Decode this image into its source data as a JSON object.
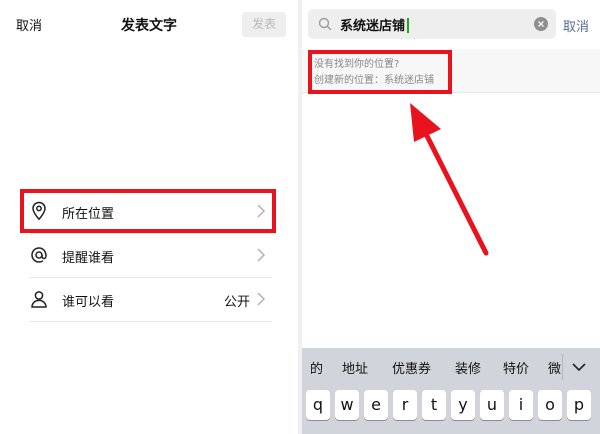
{
  "left_pane": {
    "cancel_label": "取消",
    "title": "发表文字",
    "publish_label": "发表",
    "rows": [
      {
        "icon": "location-pin-icon",
        "label": "所在位置",
        "value": ""
      },
      {
        "icon": "at-sign-icon",
        "label": "提醒谁看",
        "value": ""
      },
      {
        "icon": "person-icon",
        "label": "谁可以看",
        "value": "公开"
      }
    ]
  },
  "right_pane": {
    "search": {
      "value": "系统迷店铺",
      "icon": "search-icon",
      "clear_icon": "clear-icon"
    },
    "cancel_label": "取消",
    "result": {
      "line1": "没有找到你的位置?",
      "line2": "创建新的位置：系统迷店铺"
    }
  },
  "keyboard": {
    "suggestions": [
      "的",
      "地址",
      "优惠券",
      "装修",
      "特价",
      "微"
    ],
    "keys": [
      "q",
      "w",
      "e",
      "r",
      "t",
      "y",
      "u",
      "i",
      "o",
      "p"
    ]
  },
  "colors": {
    "highlight": "#e8131d",
    "link": "#576b95",
    "caret": "#1aad19"
  }
}
